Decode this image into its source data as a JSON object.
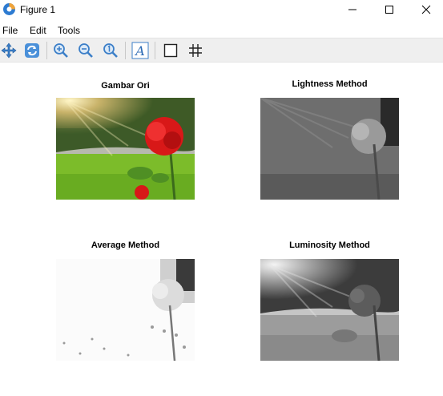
{
  "window": {
    "title": "Figure 1"
  },
  "menu": {
    "items": [
      "File",
      "Edit",
      "Tools"
    ]
  },
  "toolbar": {
    "buttons": [
      "pan-icon",
      "rotate-icon",
      "zoom-in-icon",
      "zoom-out-icon",
      "zoom-reset-icon",
      "insert-text-icon",
      "rectangle-icon",
      "grid-icon"
    ]
  },
  "figures": [
    {
      "title": "Gambar Ori",
      "kind": "color"
    },
    {
      "title": "Lightness Method",
      "kind": "lightness"
    },
    {
      "title": "Average Method",
      "kind": "average"
    },
    {
      "title": "Luminosity Method",
      "kind": "luminosity"
    }
  ],
  "colors": {
    "toolbar_bg": "#efefef",
    "icon_blue": "#3c7fc8",
    "rose_red": "#d81818",
    "grass_green": "#7cbc2a"
  }
}
